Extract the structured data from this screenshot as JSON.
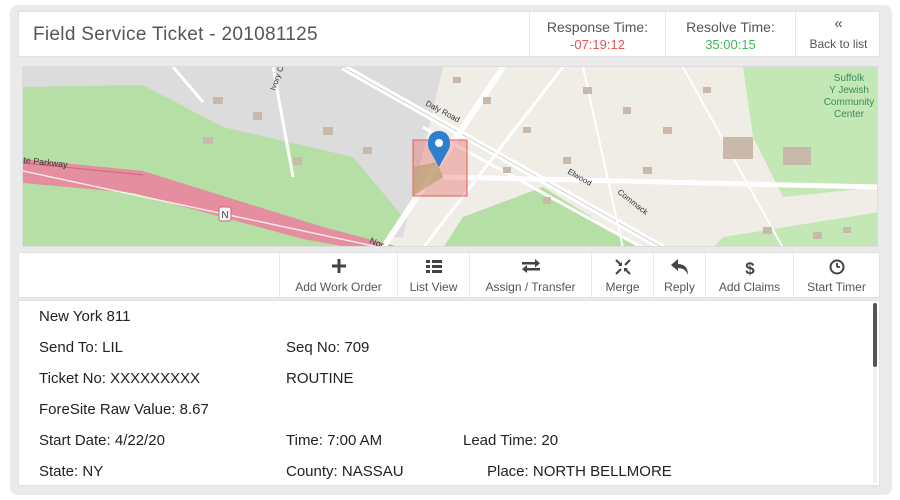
{
  "header": {
    "title": "Field Service Ticket - 201081125",
    "response_label": "Response Time:",
    "response_value": "-07:19:12",
    "resolve_label": "Resolve Time:",
    "resolve_value": "35:00:15",
    "back_label": "Back to list",
    "back_glyph": "«"
  },
  "map": {
    "labels": {
      "parkway": "Parkway",
      "parkway_prefix": "te Parkway",
      "daly": "Daly Road",
      "elwood": "Elwood",
      "commack": "Commack",
      "ivory": "Ivory C",
      "nor": "Nor",
      "route_shield": "N",
      "center_1": "Suffolk",
      "center_2": "Y Jewish",
      "center_3": "Community",
      "center_4": "Center"
    },
    "colors": {
      "highway": "#e58ea0",
      "park": "#a8d99a",
      "marker": "#2f7fd0",
      "zone": "#e85a5a"
    }
  },
  "toolbar": {
    "buttons": [
      {
        "label": "Add Work Order",
        "icon": "plus-icon"
      },
      {
        "label": "List View",
        "icon": "list-icon"
      },
      {
        "label": "Assign / Transfer",
        "icon": "transfer-icon"
      },
      {
        "label": "Merge",
        "icon": "merge-icon"
      },
      {
        "label": "Reply",
        "icon": "reply-icon"
      },
      {
        "label": "Add Claims",
        "icon": "dollar-icon"
      },
      {
        "label": "Start Timer",
        "icon": "clock-icon"
      }
    ]
  },
  "details": {
    "source": "New York 811",
    "send_to": "Send To: LIL",
    "seq_no": "Seq No:  709",
    "ticket_no": "Ticket No: XXXXXXXXX",
    "priority": "ROUTINE",
    "foresite": "ForeSite Raw Value:  8.67",
    "start_date": "Start Date:  4/22/20",
    "time": "Time:  7:00 AM",
    "lead_time": "Lead Time: 20",
    "state": "State: NY",
    "county": "County: NASSAU",
    "place": "Place: NORTH BELLMORE"
  }
}
